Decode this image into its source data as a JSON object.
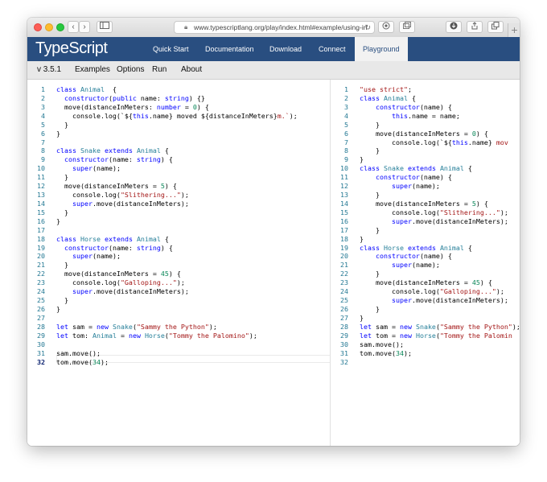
{
  "browser": {
    "url": "www.typescriptlang.org/play/index.html#example/using-in",
    "back": "‹",
    "forward": "›"
  },
  "nav": {
    "logo": "TypeScript",
    "items": [
      "Quick Start",
      "Documentation",
      "Download",
      "Connect",
      "Playground"
    ],
    "active": "Playground"
  },
  "submenu": {
    "version": "v 3.5.1",
    "items": [
      "Examples",
      "Options",
      "Run",
      "About"
    ]
  },
  "editor_left": {
    "current_line": 32,
    "lines": [
      [
        [
          "kw",
          "class "
        ],
        [
          "ty",
          "Animal"
        ],
        [
          "",
          "  {"
        ]
      ],
      [
        [
          "",
          "  "
        ],
        [
          "kw",
          "constructor"
        ],
        [
          "",
          "("
        ],
        [
          "kw",
          "public "
        ],
        [
          "",
          "name: "
        ],
        [
          "kw",
          "string"
        ],
        [
          "",
          ") {}"
        ]
      ],
      [
        [
          "",
          "  move(distanceInMeters: "
        ],
        [
          "kw",
          "number"
        ],
        [
          "",
          " = "
        ],
        [
          "nu",
          "0"
        ],
        [
          "",
          ") {"
        ]
      ],
      [
        [
          "",
          "    console.log(`${"
        ],
        [
          "kw",
          "this"
        ],
        [
          "",
          ".name} moved ${distanceInMeters}"
        ],
        [
          "st",
          "m.`"
        ],
        [
          "",
          ");"
        ]
      ],
      [
        [
          "",
          "  }"
        ]
      ],
      [
        [
          "",
          "}"
        ]
      ],
      [
        [
          "",
          ""
        ]
      ],
      [
        [
          "kw",
          "class "
        ],
        [
          "ty",
          "Snake "
        ],
        [
          "kw",
          "extends "
        ],
        [
          "ty",
          "Animal"
        ],
        [
          "",
          " {"
        ]
      ],
      [
        [
          "",
          "  "
        ],
        [
          "kw",
          "constructor"
        ],
        [
          "",
          "(name: "
        ],
        [
          "kw",
          "string"
        ],
        [
          "",
          ") {"
        ]
      ],
      [
        [
          "",
          "    "
        ],
        [
          "kw",
          "super"
        ],
        [
          "",
          "(name);"
        ]
      ],
      [
        [
          "",
          "  }"
        ]
      ],
      [
        [
          "",
          "  move(distanceInMeters = "
        ],
        [
          "nu",
          "5"
        ],
        [
          "",
          ") {"
        ]
      ],
      [
        [
          "",
          "    console.log("
        ],
        [
          "st",
          "\"Slithering...\""
        ],
        [
          "",
          ");"
        ]
      ],
      [
        [
          "",
          "    "
        ],
        [
          "kw",
          "super"
        ],
        [
          "",
          ".move(distanceInMeters);"
        ]
      ],
      [
        [
          "",
          "  }"
        ]
      ],
      [
        [
          "",
          "}"
        ]
      ],
      [
        [
          "",
          ""
        ]
      ],
      [
        [
          "kw",
          "class "
        ],
        [
          "ty",
          "Horse "
        ],
        [
          "kw",
          "extends "
        ],
        [
          "ty",
          "Animal"
        ],
        [
          "",
          " {"
        ]
      ],
      [
        [
          "",
          "  "
        ],
        [
          "kw",
          "constructor"
        ],
        [
          "",
          "(name: "
        ],
        [
          "kw",
          "string"
        ],
        [
          "",
          ") {"
        ]
      ],
      [
        [
          "",
          "    "
        ],
        [
          "kw",
          "super"
        ],
        [
          "",
          "(name);"
        ]
      ],
      [
        [
          "",
          "  }"
        ]
      ],
      [
        [
          "",
          "  move(distanceInMeters = "
        ],
        [
          "nu",
          "45"
        ],
        [
          "",
          ") {"
        ]
      ],
      [
        [
          "",
          "    console.log("
        ],
        [
          "st",
          "\"Galloping...\""
        ],
        [
          "",
          ");"
        ]
      ],
      [
        [
          "",
          "    "
        ],
        [
          "kw",
          "super"
        ],
        [
          "",
          ".move(distanceInMeters);"
        ]
      ],
      [
        [
          "",
          "  }"
        ]
      ],
      [
        [
          "",
          "}"
        ]
      ],
      [
        [
          "",
          ""
        ]
      ],
      [
        [
          "kw",
          "let "
        ],
        [
          "",
          "sam = "
        ],
        [
          "kw",
          "new "
        ],
        [
          "ty",
          "Snake"
        ],
        [
          "",
          "("
        ],
        [
          "st",
          "\"Sammy the Python\""
        ],
        [
          "",
          ");"
        ]
      ],
      [
        [
          "kw",
          "let "
        ],
        [
          "",
          "tom: "
        ],
        [
          "ty",
          "Animal"
        ],
        [
          "",
          " = "
        ],
        [
          "kw",
          "new "
        ],
        [
          "ty",
          "Horse"
        ],
        [
          "",
          "("
        ],
        [
          "st",
          "\"Tommy the Palomino\""
        ],
        [
          "",
          ");"
        ]
      ],
      [
        [
          "",
          ""
        ]
      ],
      [
        [
          "",
          "sam.move();"
        ]
      ],
      [
        [
          "",
          "tom.move("
        ],
        [
          "nu",
          "34"
        ],
        [
          "",
          ");"
        ]
      ]
    ]
  },
  "editor_right": {
    "lines": [
      [
        [
          "st",
          "\"use strict\""
        ],
        [
          "",
          ";"
        ]
      ],
      [
        [
          "kw",
          "class "
        ],
        [
          "ty",
          "Animal"
        ],
        [
          "",
          " {"
        ]
      ],
      [
        [
          "",
          "    "
        ],
        [
          "kw",
          "constructor"
        ],
        [
          "",
          "(name) {"
        ]
      ],
      [
        [
          "",
          "        "
        ],
        [
          "kw",
          "this"
        ],
        [
          "",
          ".name = name;"
        ]
      ],
      [
        [
          "",
          "    }"
        ]
      ],
      [
        [
          "",
          "    move(distanceInMeters = "
        ],
        [
          "nu",
          "0"
        ],
        [
          "",
          ") {"
        ]
      ],
      [
        [
          "",
          "        console.log(`${"
        ],
        [
          "kw",
          "this"
        ],
        [
          "",
          ".name} "
        ],
        [
          "st",
          "mov"
        ]
      ],
      [
        [
          "",
          "    }"
        ]
      ],
      [
        [
          "",
          "}"
        ]
      ],
      [
        [
          "kw",
          "class "
        ],
        [
          "ty",
          "Snake "
        ],
        [
          "kw",
          "extends "
        ],
        [
          "ty",
          "Animal"
        ],
        [
          "",
          " {"
        ]
      ],
      [
        [
          "",
          "    "
        ],
        [
          "kw",
          "constructor"
        ],
        [
          "",
          "(name) {"
        ]
      ],
      [
        [
          "",
          "        "
        ],
        [
          "kw",
          "super"
        ],
        [
          "",
          "(name);"
        ]
      ],
      [
        [
          "",
          "    }"
        ]
      ],
      [
        [
          "",
          "    move(distanceInMeters = "
        ],
        [
          "nu",
          "5"
        ],
        [
          "",
          ") {"
        ]
      ],
      [
        [
          "",
          "        console.log("
        ],
        [
          "st",
          "\"Slithering...\""
        ],
        [
          "",
          ");"
        ]
      ],
      [
        [
          "",
          "        "
        ],
        [
          "kw",
          "super"
        ],
        [
          "",
          ".move(distanceInMeters);"
        ]
      ],
      [
        [
          "",
          "    }"
        ]
      ],
      [
        [
          "",
          "}"
        ]
      ],
      [
        [
          "kw",
          "class "
        ],
        [
          "ty",
          "Horse "
        ],
        [
          "kw",
          "extends "
        ],
        [
          "ty",
          "Animal"
        ],
        [
          "",
          " {"
        ]
      ],
      [
        [
          "",
          "    "
        ],
        [
          "kw",
          "constructor"
        ],
        [
          "",
          "(name) {"
        ]
      ],
      [
        [
          "",
          "        "
        ],
        [
          "kw",
          "super"
        ],
        [
          "",
          "(name);"
        ]
      ],
      [
        [
          "",
          "    }"
        ]
      ],
      [
        [
          "",
          "    move(distanceInMeters = "
        ],
        [
          "nu",
          "45"
        ],
        [
          "",
          ") {"
        ]
      ],
      [
        [
          "",
          "        console.log("
        ],
        [
          "st",
          "\"Galloping...\""
        ],
        [
          "",
          ");"
        ]
      ],
      [
        [
          "",
          "        "
        ],
        [
          "kw",
          "super"
        ],
        [
          "",
          ".move(distanceInMeters);"
        ]
      ],
      [
        [
          "",
          "    }"
        ]
      ],
      [
        [
          "",
          "}"
        ]
      ],
      [
        [
          "kw",
          "let "
        ],
        [
          "",
          "sam = "
        ],
        [
          "kw",
          "new "
        ],
        [
          "ty",
          "Snake"
        ],
        [
          "",
          "("
        ],
        [
          "st",
          "\"Sammy the Python\""
        ],
        [
          "",
          ");"
        ]
      ],
      [
        [
          "kw",
          "let "
        ],
        [
          "",
          "tom = "
        ],
        [
          "kw",
          "new "
        ],
        [
          "ty",
          "Horse"
        ],
        [
          "",
          "("
        ],
        [
          "st",
          "\"Tommy the Palomin"
        ]
      ],
      [
        [
          "",
          "sam.move();"
        ]
      ],
      [
        [
          "",
          "tom.move("
        ],
        [
          "nu",
          "34"
        ],
        [
          "",
          ");"
        ]
      ],
      [
        [
          "",
          ""
        ]
      ]
    ]
  },
  "colors": {
    "nav_bg": "#294e80",
    "keyword": "#0000ff",
    "type": "#267f99",
    "string": "#a31515",
    "number": "#098658",
    "line_number": "#237893"
  }
}
